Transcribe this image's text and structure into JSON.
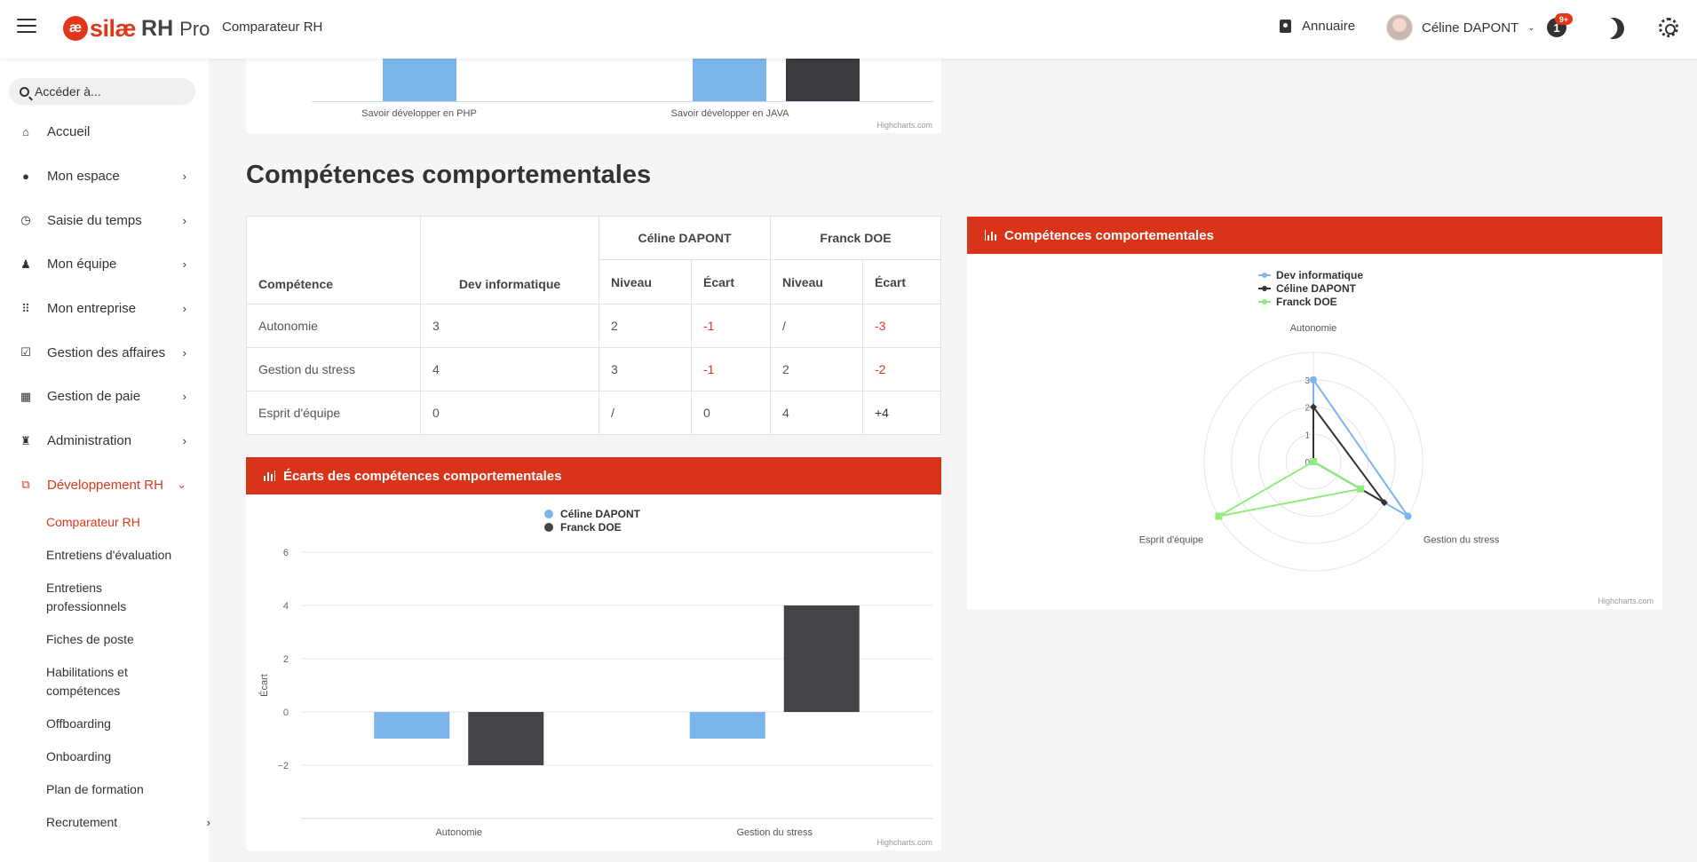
{
  "header": {
    "logo_mark": "æ",
    "logo_text": "silæ",
    "logo_product": "RH",
    "logo_product_suffix": "Pro",
    "page_title": "Comparateur RH",
    "annuaire": "Annuaire",
    "user_name": "Céline DAPONT",
    "notif_badge": "9+",
    "notif_glyph": "1"
  },
  "sidebar": {
    "search_placeholder": "Accéder à...",
    "items": [
      {
        "label": "Accueil",
        "icon": "home-icon",
        "arrow": ""
      },
      {
        "label": "Mon espace",
        "icon": "person-icon",
        "arrow": "›"
      },
      {
        "label": "Saisie du temps",
        "icon": "clock-icon",
        "arrow": "›"
      },
      {
        "label": "Mon équipe",
        "icon": "team-icon",
        "arrow": "›"
      },
      {
        "label": "Mon entreprise",
        "icon": "grid-icon",
        "arrow": "›"
      },
      {
        "label": "Gestion des affaires",
        "icon": "clipboard-icon",
        "arrow": "›"
      },
      {
        "label": "Gestion de paie",
        "icon": "calculator-icon",
        "arrow": "›"
      },
      {
        "label": "Administration",
        "icon": "admin-icon",
        "arrow": "›"
      },
      {
        "label": "Développement RH",
        "icon": "development-icon",
        "arrow": "⌄"
      }
    ],
    "subitems": [
      {
        "label": "Comparateur RH"
      },
      {
        "label": "Entretiens d'évaluation"
      },
      {
        "label": "Entretiens professionnels"
      },
      {
        "label": "Fiches de poste"
      },
      {
        "label": "Habilitations et compétences"
      },
      {
        "label": "Offboarding"
      },
      {
        "label": "Onboarding"
      },
      {
        "label": "Plan de formation"
      },
      {
        "label": "Recrutement"
      }
    ]
  },
  "top_chart": {
    "categories": [
      "Savoir développer en PHP",
      "Savoir développer en JAVA"
    ],
    "credit": "Highcharts.com"
  },
  "section_title": "Compétences comportementales",
  "table": {
    "col_competence": "Compétence",
    "col_dev": "Dev informatique",
    "person1": "Céline DAPONT",
    "person2": "Franck DOE",
    "niveau": "Niveau",
    "ecart": "Écart",
    "rows": [
      {
        "competence": "Autonomie",
        "dev": "3",
        "p1_niveau": "2",
        "p1_ecart": "-1",
        "p2_niveau": "/",
        "p2_ecart": "-3"
      },
      {
        "competence": "Gestion du stress",
        "dev": "4",
        "p1_niveau": "3",
        "p1_ecart": "-1",
        "p2_niveau": "2",
        "p2_ecart": "-2"
      },
      {
        "competence": "Esprit d'équipe",
        "dev": "0",
        "p1_niveau": "/",
        "p1_ecart": "0",
        "p2_niveau": "4",
        "p2_ecart": "+4"
      }
    ]
  },
  "ecarts_panel": {
    "title": "Écarts des compétences comportementales",
    "credit": "Highcharts.com"
  },
  "radar_panel": {
    "title": "Compétences comportementales",
    "credit": "Highcharts.com"
  },
  "chart_data": [
    {
      "type": "bar",
      "title": "Écarts des compétences comportementales",
      "categories": [
        "Autonomie",
        "Gestion du stress"
      ],
      "ylabel": "Écart",
      "ylim": [
        -4,
        6
      ],
      "yticks": [
        "6",
        "4",
        "2",
        "0",
        "−2"
      ],
      "legend": "top-center",
      "series": [
        {
          "name": "Céline DAPONT",
          "color": "#7cb5ec",
          "values": [
            -1,
            -1
          ]
        },
        {
          "name": "Franck DOE",
          "color": "#434348",
          "values": [
            -2,
            4
          ]
        }
      ]
    },
    {
      "type": "radar",
      "title": "Compétences comportementales",
      "categories": [
        "Autonomie",
        "Gestion du stress",
        "Esprit d'équipe"
      ],
      "ylim": [
        0,
        4
      ],
      "yticks": [
        "0",
        "1",
        "2",
        "3"
      ],
      "legend": "top-center",
      "series": [
        {
          "name": "Dev informatique",
          "color": "#7cb5ec",
          "values": [
            3,
            4,
            0
          ]
        },
        {
          "name": "Céline DAPONT",
          "color": "#333333",
          "values": [
            2,
            3,
            0
          ]
        },
        {
          "name": "Franck DOE",
          "color": "#90ed7d",
          "values": [
            0,
            2,
            4
          ]
        }
      ]
    }
  ]
}
